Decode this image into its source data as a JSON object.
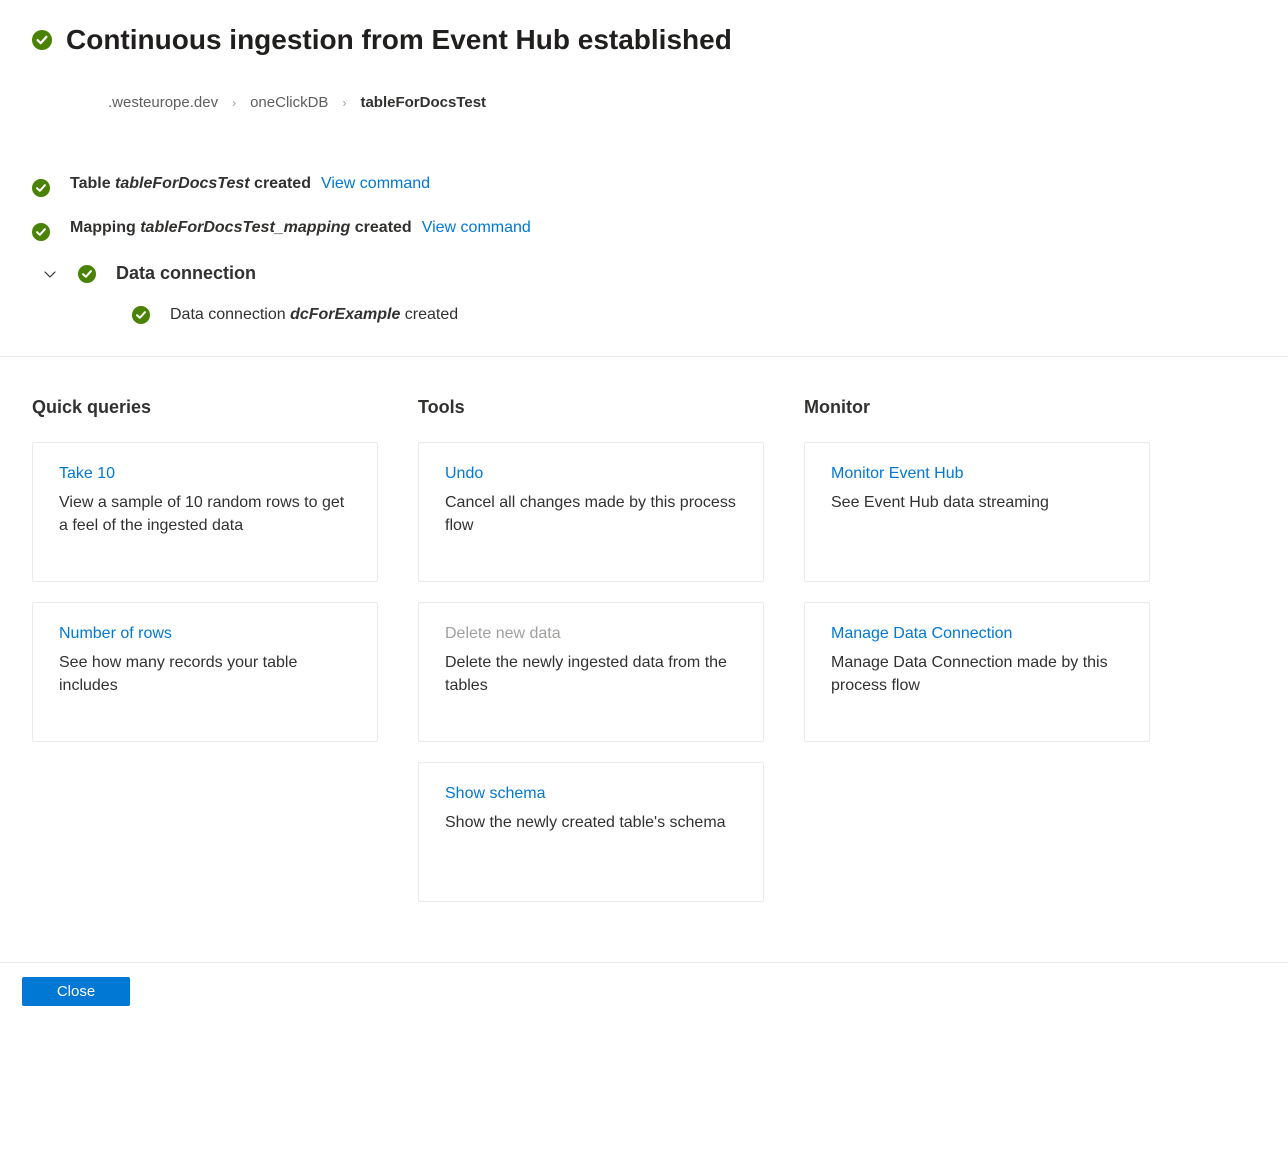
{
  "header": {
    "title": "Continuous ingestion from Event Hub established"
  },
  "breadcrumb": {
    "cluster": ".westeurope.dev",
    "database": "oneClickDB",
    "table": "tableForDocsTest"
  },
  "status": {
    "table": {
      "prefix": "Table ",
      "name": "tableForDocsTest",
      "suffix": " created",
      "link": "View command"
    },
    "mapping": {
      "prefix": "Mapping ",
      "name": "tableForDocsTest_mapping",
      "suffix": " created",
      "link": "View command"
    },
    "dataConnection": {
      "label": "Data connection",
      "sub": {
        "prefix": "Data connection ",
        "name": "dcForExample",
        "suffix": " created"
      }
    }
  },
  "columns": {
    "quickQueries": {
      "title": "Quick queries",
      "cards": [
        {
          "title": "Take 10",
          "desc": "View a sample of 10 random rows to get a feel of the ingested data",
          "disabled": false
        },
        {
          "title": "Number of rows",
          "desc": "See how many records your table includes",
          "disabled": false
        }
      ]
    },
    "tools": {
      "title": "Tools",
      "cards": [
        {
          "title": "Undo",
          "desc": "Cancel all changes made by this process flow",
          "disabled": false
        },
        {
          "title": "Delete new data",
          "desc": "Delete the newly ingested data from the tables",
          "disabled": true
        },
        {
          "title": "Show schema",
          "desc": "Show the newly created table's schema",
          "disabled": false
        }
      ]
    },
    "monitor": {
      "title": "Monitor",
      "cards": [
        {
          "title": "Monitor Event Hub",
          "desc": "See Event Hub data streaming",
          "disabled": false
        },
        {
          "title": "Manage Data Connection",
          "desc": "Manage Data Connection made by this process flow",
          "disabled": false
        }
      ]
    }
  },
  "footer": {
    "close": "Close"
  }
}
